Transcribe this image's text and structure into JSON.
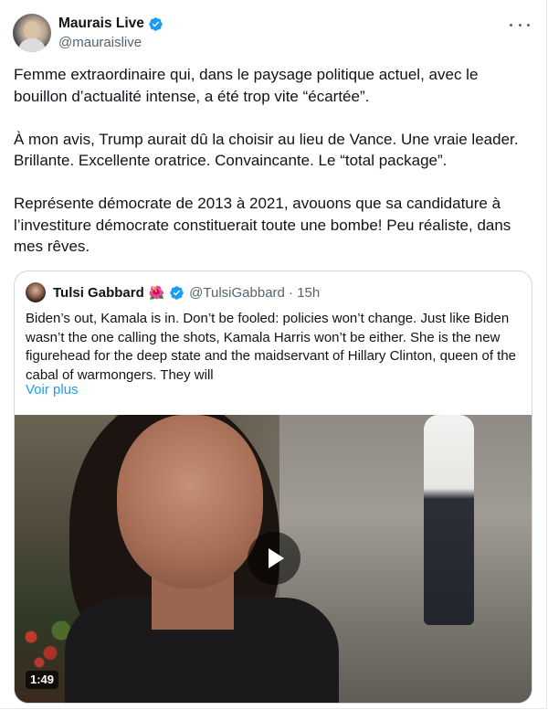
{
  "author": {
    "display_name": "Maurais Live",
    "handle": "@mauraislive",
    "verified": true
  },
  "icons": {
    "more": "more-horizontal-icon",
    "verified": "verified-badge-icon",
    "play": "play-icon"
  },
  "colors": {
    "verified_badge": "#1d9bf0",
    "link": "#1d9bf0",
    "secondary_text": "#536471"
  },
  "tweet": {
    "paragraphs": [
      "Femme extraordinaire qui, dans le paysage politique actuel, avec le bouillon d’actualité intense, a été trop vite “écartée”.",
      "À mon avis, Trump aurait dû la choisir au lieu de Vance. Une vraie leader. Brillante. Excellente oratrice. Convaincante. Le “total package”.",
      "Représente démocrate de 2013 à 2021, avouons que sa candidature à l’investiture démocrate constituerait toute une bombe! Peu réaliste, dans mes rêves."
    ]
  },
  "quoted_tweet": {
    "display_name": "Tulsi Gabbard",
    "emoji": "🌺",
    "verified": true,
    "handle_time": "@TulsiGabbard · 15h",
    "text": "Biden’s out, Kamala is in. Don’t be fooled: policies won’t change.  Just like Biden wasn’t the one calling the shots, Kamala Harris won’t be either. She is the new figurehead for the deep state and the maidservant of Hillary Clinton, queen of the cabal of warmongers. They will",
    "see_more": "Voir plus",
    "video_duration": "1:49"
  }
}
